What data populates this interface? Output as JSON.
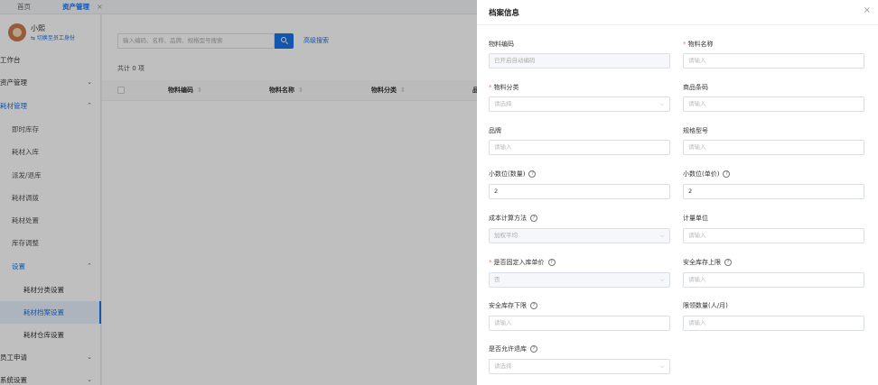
{
  "tabs": [
    {
      "label": "首页",
      "active": false
    },
    {
      "label": "资产管理",
      "active": true
    }
  ],
  "tab_close": "×",
  "user": {
    "name": "小熙",
    "switch_text": "⇆ 切换至员工身份"
  },
  "sidebar": {
    "items": [
      {
        "label": "工作台",
        "level": 0,
        "chevron": ""
      },
      {
        "label": "资产管理",
        "level": 0,
        "chevron": "⌄"
      },
      {
        "label": "耗材管理",
        "level": 0,
        "chevron": "⌃"
      },
      {
        "label": "即时库存",
        "level": 1,
        "chevron": ""
      },
      {
        "label": "耗材入库",
        "level": 1,
        "chevron": ""
      },
      {
        "label": "派发/退库",
        "level": 1,
        "chevron": ""
      },
      {
        "label": "耗材调拨",
        "level": 1,
        "chevron": ""
      },
      {
        "label": "耗材处置",
        "level": 1,
        "chevron": ""
      },
      {
        "label": "库存调整",
        "level": 1,
        "chevron": ""
      },
      {
        "label": "设置",
        "level": 1,
        "chevron": "⌃"
      },
      {
        "label": "耗材分类设置",
        "level": 2,
        "chevron": ""
      },
      {
        "label": "耗材档案设置",
        "level": 2,
        "chevron": ""
      },
      {
        "label": "耗材仓库设置",
        "level": 2,
        "chevron": ""
      },
      {
        "label": "员工申请",
        "level": 0,
        "chevron": "⌄"
      },
      {
        "label": "系统设置",
        "level": 0,
        "chevron": "⌄"
      }
    ]
  },
  "main": {
    "search_placeholder": "输入编码、名称、品牌、规格型号搜索",
    "advanced_search": "高级搜索",
    "total": "共计 0 项",
    "columns": [
      "物料编码",
      "物料名称",
      "物料分类",
      "品"
    ],
    "sort_glyph": "⇕"
  },
  "drawer": {
    "title": "档案信息",
    "close": "×",
    "fields": {
      "code": {
        "label": "物料编码",
        "value": "已开启自动编码"
      },
      "name": {
        "label": "物料名称",
        "placeholder": "请输入"
      },
      "category": {
        "label": "物料分类",
        "placeholder": "请选择"
      },
      "barcode": {
        "label": "商品条码",
        "placeholder": "请输入"
      },
      "brand": {
        "label": "品牌",
        "placeholder": "请输入"
      },
      "spec": {
        "label": "规格型号",
        "placeholder": "请输入"
      },
      "decimal_qty": {
        "label": "小数位(数量)",
        "value": "2"
      },
      "decimal_price": {
        "label": "小数位(单价)",
        "value": "2"
      },
      "cost_method": {
        "label": "成本计算方法",
        "value": "加权平均"
      },
      "unit": {
        "label": "计量单位",
        "placeholder": "请输入"
      },
      "fixed_price": {
        "label": "是否固定入库单价",
        "value": "否"
      },
      "safety_upper": {
        "label": "安全库存上限",
        "placeholder": "请输入"
      },
      "safety_lower": {
        "label": "安全库存下限",
        "placeholder": "请输入"
      },
      "claim_limit": {
        "label": "限领数量(人/月)",
        "placeholder": "请输入"
      },
      "allow_return": {
        "label": "是否允许退库",
        "placeholder": "请选择"
      }
    },
    "help_glyph": "?",
    "required_mark": "*",
    "dropdown_glyph": "⌵"
  }
}
